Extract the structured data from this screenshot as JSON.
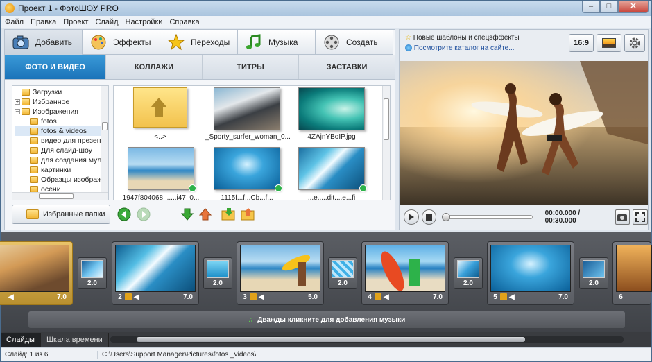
{
  "window": {
    "title": "Проект 1 - ФотоШОУ PRO",
    "min": "–",
    "max": "□",
    "close": "✕"
  },
  "menu": [
    "Файл",
    "Правка",
    "Проект",
    "Слайд",
    "Настройки",
    "Справка"
  ],
  "tabs": [
    {
      "label": "Добавить"
    },
    {
      "label": "Эффекты"
    },
    {
      "label": "Переходы"
    },
    {
      "label": "Музыка"
    },
    {
      "label": "Создать"
    }
  ],
  "subtabs": [
    "ФОТО И ВИДЕО",
    "КОЛЛАЖИ",
    "ТИТРЫ",
    "ЗАСТАВКИ"
  ],
  "tree": [
    {
      "label": "Загрузки",
      "indent": 0,
      "exp": false
    },
    {
      "label": "Избранное",
      "indent": 0,
      "exp": "+"
    },
    {
      "label": "Изображения",
      "indent": 0,
      "exp": "–"
    },
    {
      "label": "fotos",
      "indent": 1,
      "exp": false
    },
    {
      "label": "fotos & videos",
      "indent": 1,
      "exp": false,
      "sel": true
    },
    {
      "label": "видео для презен",
      "indent": 1,
      "exp": false
    },
    {
      "label": "Для слайд-шоу",
      "indent": 1,
      "exp": false
    },
    {
      "label": "для создания мул",
      "indent": 1,
      "exp": false
    },
    {
      "label": "картинки",
      "indent": 1,
      "exp": false
    },
    {
      "label": "Образцы изображ",
      "indent": 1,
      "exp": false
    },
    {
      "label": "осени",
      "indent": 1,
      "exp": false
    }
  ],
  "files": [
    {
      "label": "<..>"
    },
    {
      "label": "_Sporty_surfer_woman_0..."
    },
    {
      "label": "4ZAjnYBoIP.jpg"
    },
    {
      "label": "1947f804068_.....j47_0..."
    },
    {
      "label": "1115f...f...Cb...f..."
    },
    {
      "label": "...e.....dit....e...fi"
    }
  ],
  "fav_button": "Избранные папки",
  "news": {
    "line1": "Новые шаблоны и спецэффекты",
    "line2": "Посмотрите каталог на сайте..."
  },
  "aspect": "16:9",
  "player": {
    "time": "00:00.000 / 00:30.000",
    "progress": 0
  },
  "slides": [
    {
      "num": "",
      "dur": "7.0"
    },
    {
      "num": "2",
      "dur": "7.0"
    },
    {
      "num": "3",
      "dur": "5.0"
    },
    {
      "num": "4",
      "dur": "7.0"
    },
    {
      "num": "5",
      "dur": "7.0"
    },
    {
      "num": "6",
      "dur": ""
    }
  ],
  "transitions": [
    "2.0",
    "2.0",
    "2.0",
    "2.0",
    "2.0"
  ],
  "music_hint": "Дважды кликните для добавления музыки",
  "bottom_tabs": [
    "Слайды",
    "Шкала времени"
  ],
  "status": {
    "slide": "Слайд: 1 из 6",
    "path": "C:\\Users\\Support Manager\\Pictures\\fotos _videos\\"
  }
}
